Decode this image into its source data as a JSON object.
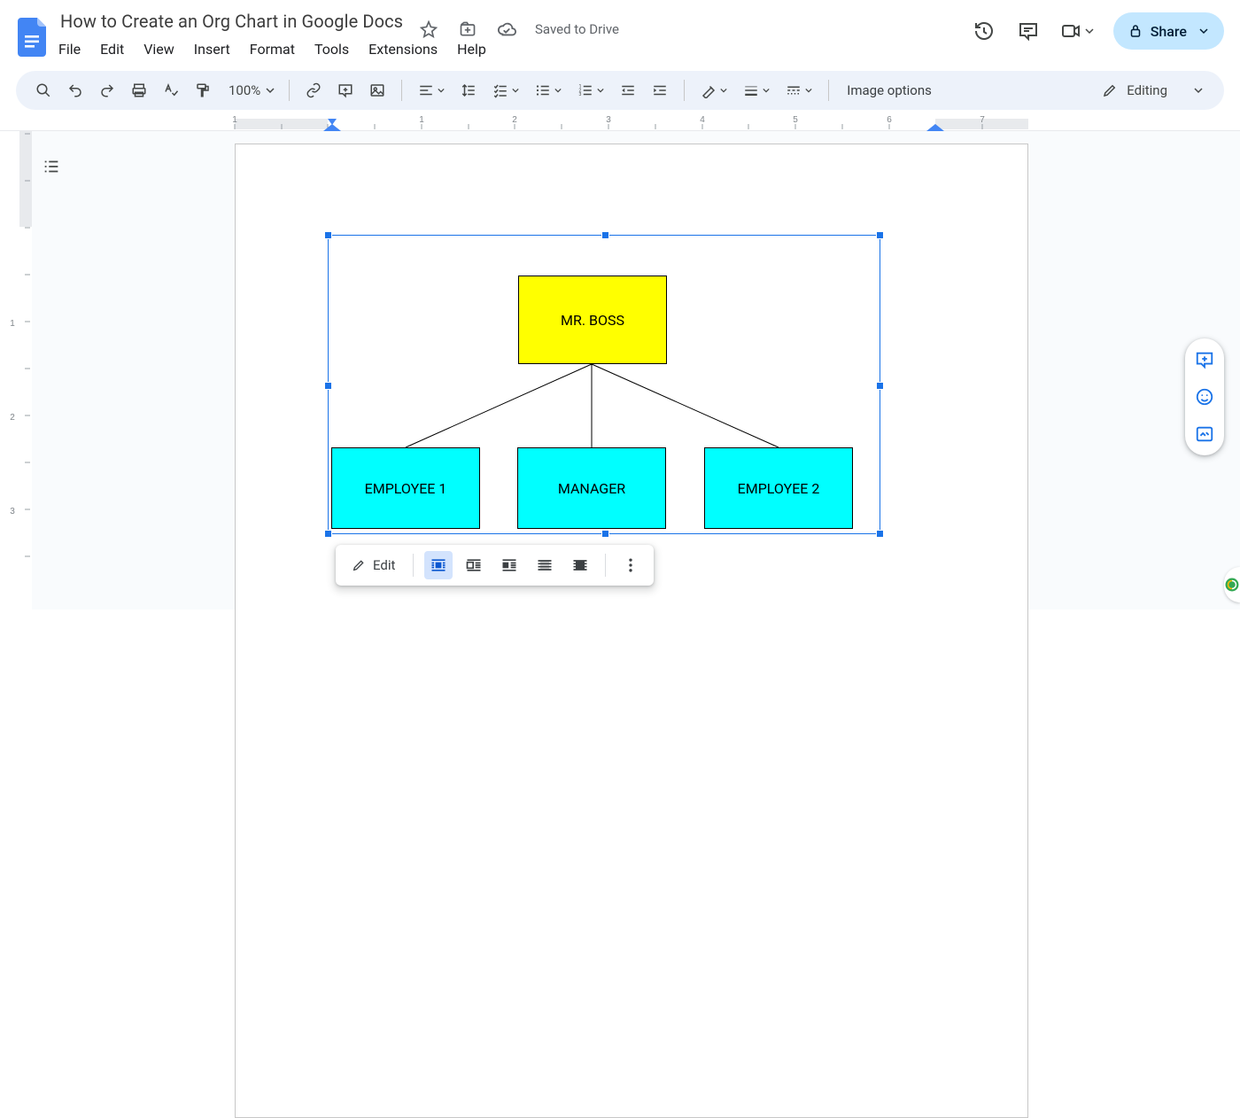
{
  "header": {
    "doc_title": "How to Create an Org Chart in Google Docs",
    "save_status": "Saved to Drive",
    "share_label": "Share"
  },
  "menus": {
    "file": "File",
    "edit": "Edit",
    "view": "View",
    "insert": "Insert",
    "format": "Format",
    "tools": "Tools",
    "extensions": "Extensions",
    "help": "Help"
  },
  "toolbar": {
    "zoom": "100%",
    "image_options": "Image options",
    "editing_label": "Editing"
  },
  "ruler": {
    "h_marks": [
      "1",
      "2",
      "3",
      "4",
      "5",
      "6",
      "7"
    ],
    "v_marks": [
      "1",
      "2",
      "3"
    ]
  },
  "drawing": {
    "boss": "MR. BOSS",
    "child1": "EMPLOYEE 1",
    "child2": "MANAGER",
    "child3": "EMPLOYEE 2"
  },
  "float_toolbar": {
    "edit": "Edit"
  },
  "colors": {
    "accent": "#1a73e8",
    "share_bg": "#c3e7ff",
    "boss_bg": "#ffff00",
    "child_bg": "#00ffff"
  }
}
